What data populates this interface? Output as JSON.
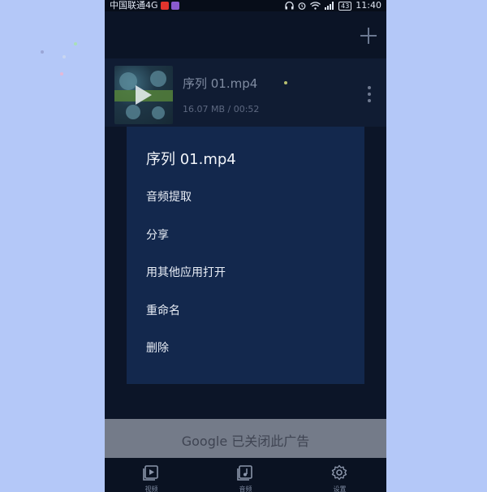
{
  "status_bar": {
    "carrier": "中国联通4G",
    "battery": "43",
    "time": "11:40"
  },
  "file": {
    "name": "序列 01.mp4",
    "meta": "16.07 MB / 00:52"
  },
  "context_menu": {
    "title": "序列 01.mp4",
    "items": [
      "音频提取",
      "分享",
      "用其他应用打开",
      "重命名",
      "删除"
    ]
  },
  "ad_banner": {
    "text": "Google 已关闭此广告"
  },
  "bottom_nav": {
    "tabs": [
      {
        "label": "视频",
        "icon": "video-icon"
      },
      {
        "label": "音频",
        "icon": "music-note-icon"
      },
      {
        "label": "设置",
        "icon": "gear-icon"
      }
    ]
  },
  "colors": {
    "page_background": "#b4c8f8",
    "app_background": "#0a1222",
    "menu_background": "#13284d",
    "ad_background": "#747b89"
  }
}
